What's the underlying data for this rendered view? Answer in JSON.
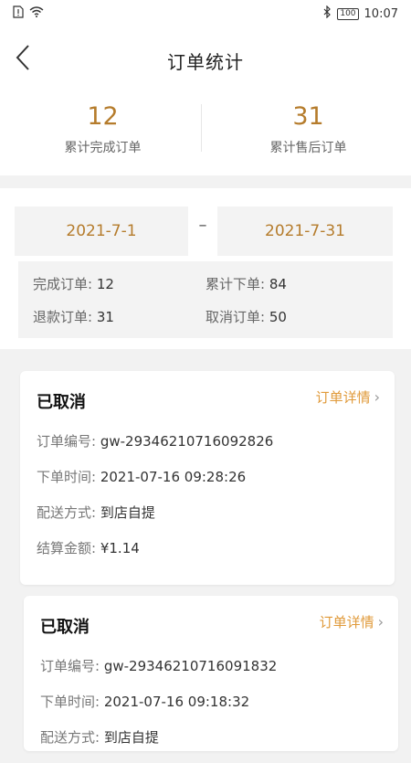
{
  "status_bar": {
    "time": "10:07",
    "battery": "100"
  },
  "header": {
    "title": "订单统计"
  },
  "summary": {
    "completed_value": "12",
    "completed_label": "累计完成订单",
    "aftersale_value": "31",
    "aftersale_label": "累计售后订单"
  },
  "filter": {
    "start_date": "2021-7-1",
    "separator": "–",
    "end_date": "2021-7-31",
    "counts": {
      "completed_label": "完成订单:",
      "completed_value": "12",
      "total_label": "累计下单:",
      "total_value": "84",
      "refund_label": "退款订单:",
      "refund_value": "31",
      "cancel_label": "取消订单:",
      "cancel_value": "50"
    }
  },
  "orders": [
    {
      "status": "已取消",
      "detail_link": "订单详情",
      "order_no_label": "订单编号:",
      "order_no": "gw-29346210716092826",
      "time_label": "下单时间:",
      "time": "2021-07-16 09:28:26",
      "delivery_label": "配送方式:",
      "delivery": "到店自提",
      "amount_label": "结算金额:",
      "amount": "¥1.14"
    },
    {
      "status": "已取消",
      "detail_link": "订单详情",
      "order_no_label": "订单编号:",
      "order_no": "gw-29346210716091832",
      "time_label": "下单时间:",
      "time": "2021-07-16 09:18:32",
      "delivery_label": "配送方式:",
      "delivery": "到店自提"
    }
  ],
  "colors": {
    "accent_gold": "#b57c2c",
    "link_orange": "#e09a3a",
    "background": "#f2f2f2"
  }
}
